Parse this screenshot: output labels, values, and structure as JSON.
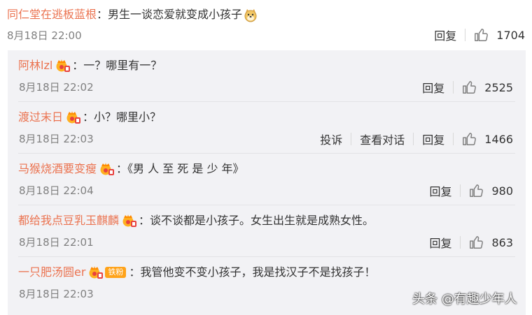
{
  "main_comment": {
    "user": "同仁堂在逃板蓝根",
    "text": "：男生一谈恋爱就变成小孩子",
    "date": "8月18日 22:00",
    "reply_label": "回复",
    "likes": "1704"
  },
  "replies": [
    {
      "user": "阿林lzl",
      "text": "：一？哪里有一？",
      "date": "8月18日 22:02",
      "actions": [
        "回复"
      ],
      "likes": "2525"
    },
    {
      "user": "渡过末日",
      "text": "：小？哪里小？",
      "date": "8月18日 22:03",
      "actions": [
        "投诉",
        "查看对话",
        "回复"
      ],
      "likes": "1466"
    },
    {
      "user": "马猴烧酒要变瘦",
      "text": "：《男 人 至 死 是 少 年》",
      "date": "8月18日 22:04",
      "actions": [
        "回复"
      ],
      "likes": "980"
    },
    {
      "user": "都给我点豆乳玉麒麟",
      "text": "：谈不谈都是小孩子。女生出生就是成熟女性。",
      "date": "8月18日 22:01",
      "actions": [
        "回复"
      ],
      "likes": "863"
    },
    {
      "user": "一只肥汤圆er",
      "text": "：我管他变不变小孩子，我是找汉子不是找孩子！",
      "date": "8月18日 22:03",
      "fan_label": "铁粉",
      "actions": [],
      "likes": ""
    }
  ],
  "watermark": "头条 @有趣少年人",
  "colors": {
    "username": "#eb7350",
    "panel_bg": "#f2f2f5",
    "date": "#808080"
  },
  "icons": [
    "thumbs-up-icon",
    "vip-crown-badge-icon",
    "doge-emoji-icon"
  ]
}
